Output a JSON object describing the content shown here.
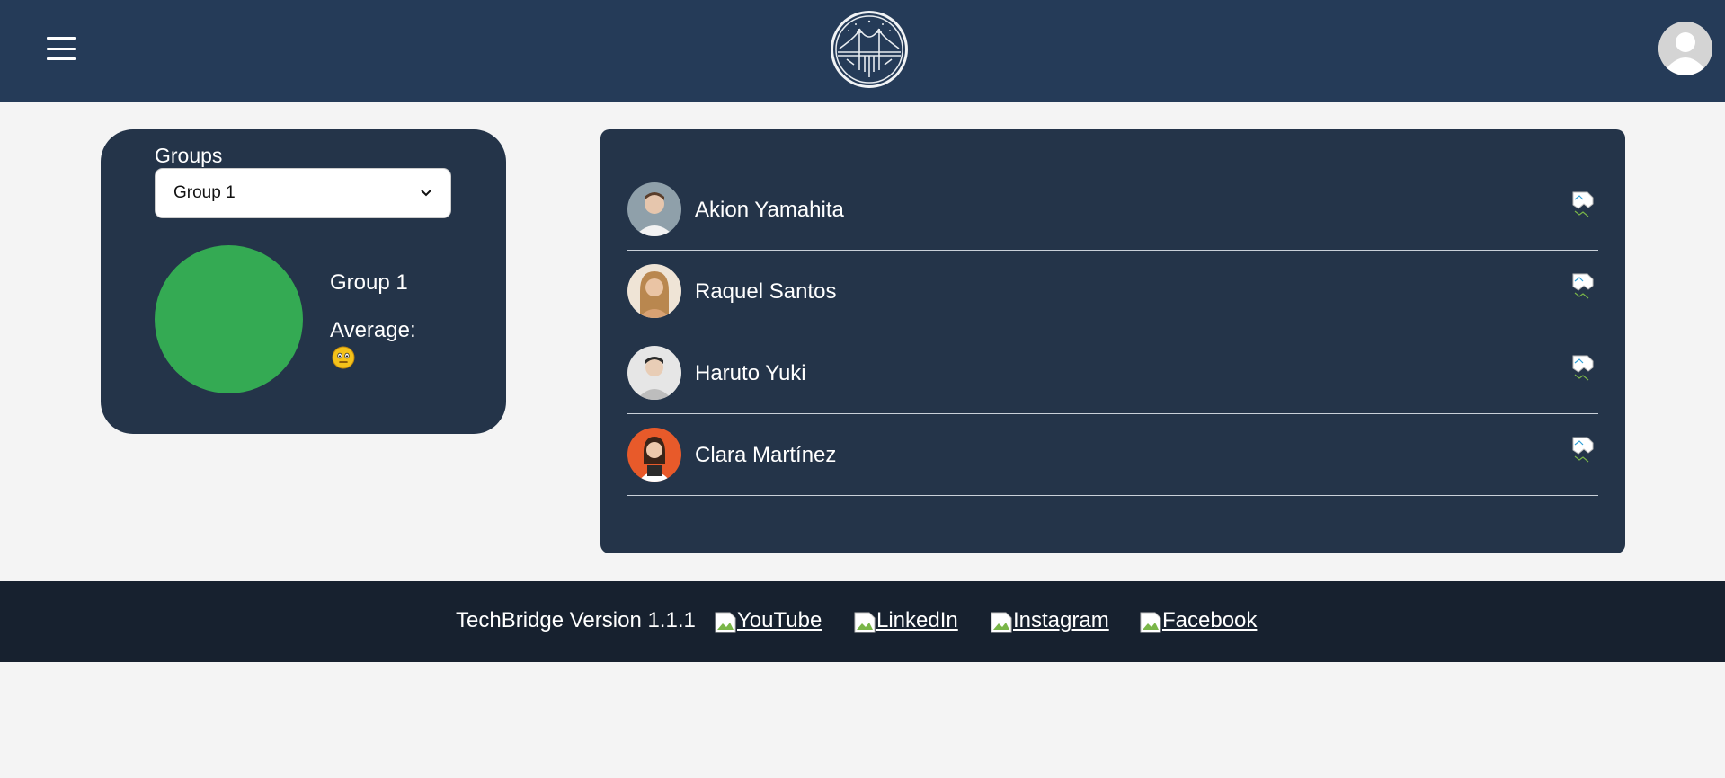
{
  "header": {
    "menu_icon": "hamburger-menu-icon",
    "logo_icon": "techbridge-bridge-logo",
    "profile_icon": "user-avatar-icon"
  },
  "groups": {
    "label": "Groups",
    "selected": "Group 1",
    "group_name": "Group 1",
    "average_label": "Average:",
    "average_icon": "smiley-emoji-icon",
    "circle_color": "#34aa53"
  },
  "members": [
    {
      "name": "Akion Yamahita",
      "avatar_color": "#9aa6ae"
    },
    {
      "name": "Raquel Santos",
      "avatar_color": "#d8b48c"
    },
    {
      "name": "Haruto Yuki",
      "avatar_color": "#e2e2e2"
    },
    {
      "name": "Clara Martínez",
      "avatar_color": "#e85a2a"
    }
  ],
  "footer": {
    "version_text": "TechBridge Version 1.1.1",
    "links": [
      "YouTube",
      "LinkedIn",
      "Instagram",
      "Facebook"
    ]
  },
  "colors": {
    "header_bg": "#253b58",
    "card_bg": "#243449",
    "footer_bg": "#17212f",
    "page_bg": "#f4f4f4"
  }
}
